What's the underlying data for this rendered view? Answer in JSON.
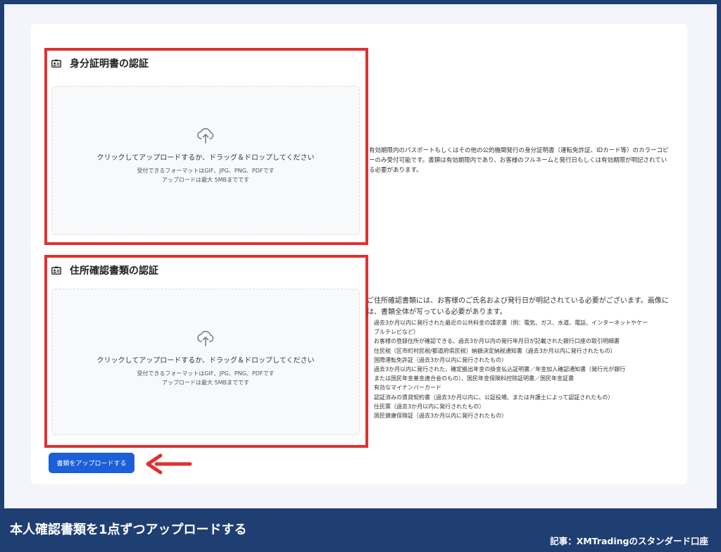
{
  "sections": [
    {
      "title": "身分証明書の認証",
      "icon": "id-card-icon",
      "dropzone": {
        "main": "クリックしてアップロードするか、ドラッグ＆ドロップしてください",
        "format": "受付できるフォーマットはGIF、JPG、PNG、PDFです",
        "size": "アップロードは最大 5MBまでです"
      },
      "description": [
        "有効期限内のパスポートもしくはその他の公的機関発行の身分証明書（運転免許証、IDカード等）のカラーコピ",
        "ーのみ受付可能です。書類は有効期限内であり、お客様のフルネームと発行日もしくは有効期限が明記されてい",
        "る必要があります。"
      ]
    },
    {
      "title": "住所確認書類の認証",
      "icon": "id-card-icon",
      "dropzone": {
        "main": "クリックしてアップロードするか、ドラッグ＆ドロップしてください",
        "format": "受付できるフォーマットはGIF、JPG、PNG、PDFです",
        "size": "アップロードは最大 5MBまでです"
      },
      "description": [
        "ご住所確認書類には、お客様のご氏名および発行日が明記されている必要がございます。画像に",
        "は、書類全体が写っている必要があります。"
      ],
      "accepted_documents": [
        "過去3か月以内に発行された最近の公共料金の請求書（例：電気、ガス、水道、電話、インターネットやケー",
        "ブルテレビなど）",
        "お客様の登録住所が確認できる、過去3か月以内の発行年月日が記載された銀行口座の取引明細書",
        "住民税（区市町村民税/都道府県民税）納額決定納税通知書（過去3か月以内に発行されたもの）",
        "国際運転免許証（過去3か月以内に発行されたもの）",
        "過去3か月以内に発行された、確定拠出年金の掛金払込証明書／年金加入確認通知書（発行元が銀行",
        "または国民年金基金連合会のもの）、国民年金保険料控除証明書／国民年金証書",
        "有効なマイナンバーカード",
        "認証済みの賃貸契約書（過去3か月以内に、公証役場、または弁護士によって認証されたもの）",
        "住民票（過去3か月以内に発行されたもの）",
        "国民健康保険証（過去3か月以内に発行されたもの）"
      ]
    }
  ],
  "upload_button": "書類をアップロードする",
  "footer": {
    "caption": "本人確認書類を1点ずつアップロードする",
    "article": "記事：XMTradingのスタンダード口座"
  },
  "colors": {
    "highlight": "#e03131",
    "button": "#1c5fd8",
    "footer_bg": "#1f3f73"
  }
}
